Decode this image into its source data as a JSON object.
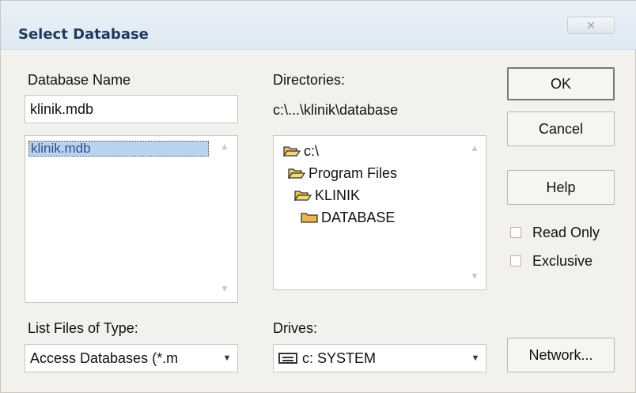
{
  "window": {
    "title": "Select Database",
    "close_glyph": "✕"
  },
  "database_name": {
    "label": "Database Name",
    "value": "klinik.mdb",
    "files": [
      "klinik.mdb"
    ]
  },
  "directories": {
    "label": "Directories:",
    "current_path": "c:\\...\\klinik\\database",
    "items": [
      {
        "name": "c:\\",
        "icon": "open-folder-icon"
      },
      {
        "name": "Program Files",
        "icon": "open-folder-icon"
      },
      {
        "name": "KLINIK",
        "icon": "open-folder-icon"
      },
      {
        "name": "DATABASE",
        "icon": "folder-icon"
      }
    ]
  },
  "buttons": {
    "ok": "OK",
    "cancel": "Cancel",
    "help": "Help",
    "network": "Network..."
  },
  "options": {
    "read_only": "Read Only",
    "exclusive": "Exclusive"
  },
  "file_type": {
    "label": "List Files of Type:",
    "selected": "Access Databases (*.m"
  },
  "drives": {
    "label": "Drives:",
    "selected": "c: SYSTEM"
  },
  "colors": {
    "title": "#1f3a5f",
    "selection": "#b9d3ef",
    "folder": "#f2c55c"
  }
}
